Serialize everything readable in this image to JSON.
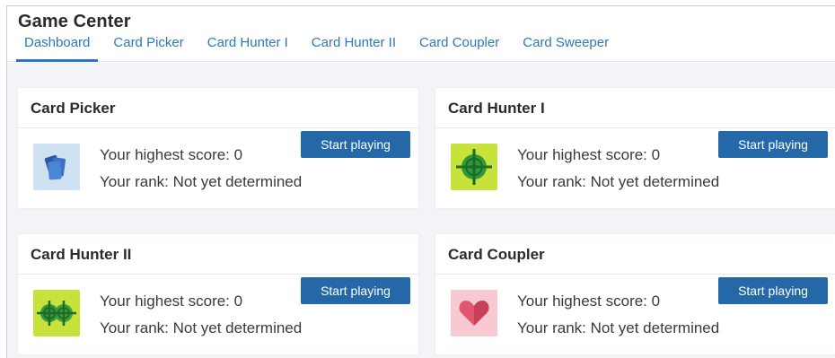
{
  "app": {
    "title": "Game Center"
  },
  "tabs": [
    {
      "label": "Dashboard",
      "active": true
    },
    {
      "label": "Card Picker"
    },
    {
      "label": "Card Hunter I"
    },
    {
      "label": "Card Hunter II"
    },
    {
      "label": "Card Coupler"
    },
    {
      "label": "Card Sweeper"
    }
  ],
  "cards": [
    {
      "title": "Card Picker",
      "icon": "stacked-cards-icon",
      "score": "Your highest score: 0",
      "rank": "Your rank: Not yet determined",
      "button": "Start playing"
    },
    {
      "title": "Card Hunter I",
      "icon": "crosshair-target-icon",
      "score": "Your highest score: 0",
      "rank": "Your rank: Not yet determined",
      "button": "Start playing"
    },
    {
      "title": "Card Hunter II",
      "icon": "double-crosshair-icon",
      "score": "Your highest score: 0",
      "rank": "Your rank: Not yet determined",
      "button": "Start playing"
    },
    {
      "title": "Card Coupler",
      "icon": "heart-icon",
      "score": "Your highest score: 0",
      "rank": "Your rank: Not yet determined",
      "button": "Start playing"
    }
  ],
  "colors": {
    "accent": "#2f77b8",
    "button": "#2468a8",
    "background": "#f2f4f7"
  }
}
